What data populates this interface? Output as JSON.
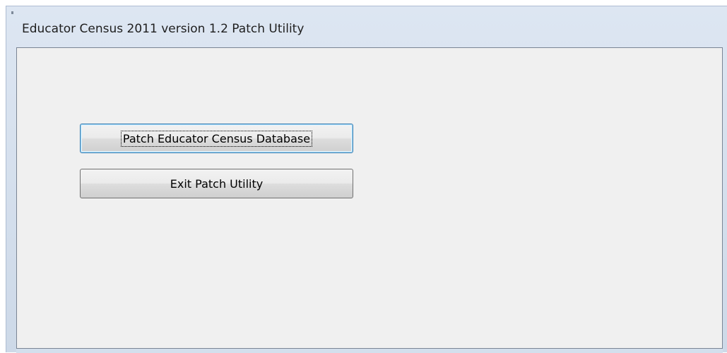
{
  "window": {
    "title": "Educator Census 2011 version 1.2  Patch Utility"
  },
  "buttons": {
    "patch_label": "Patch Educator Census Database",
    "exit_label": "Exit Patch Utility"
  },
  "colors": {
    "client_background": "#f0f0f0",
    "frame": "#cdd9e8",
    "default_button_border": "#3c7fb1"
  }
}
